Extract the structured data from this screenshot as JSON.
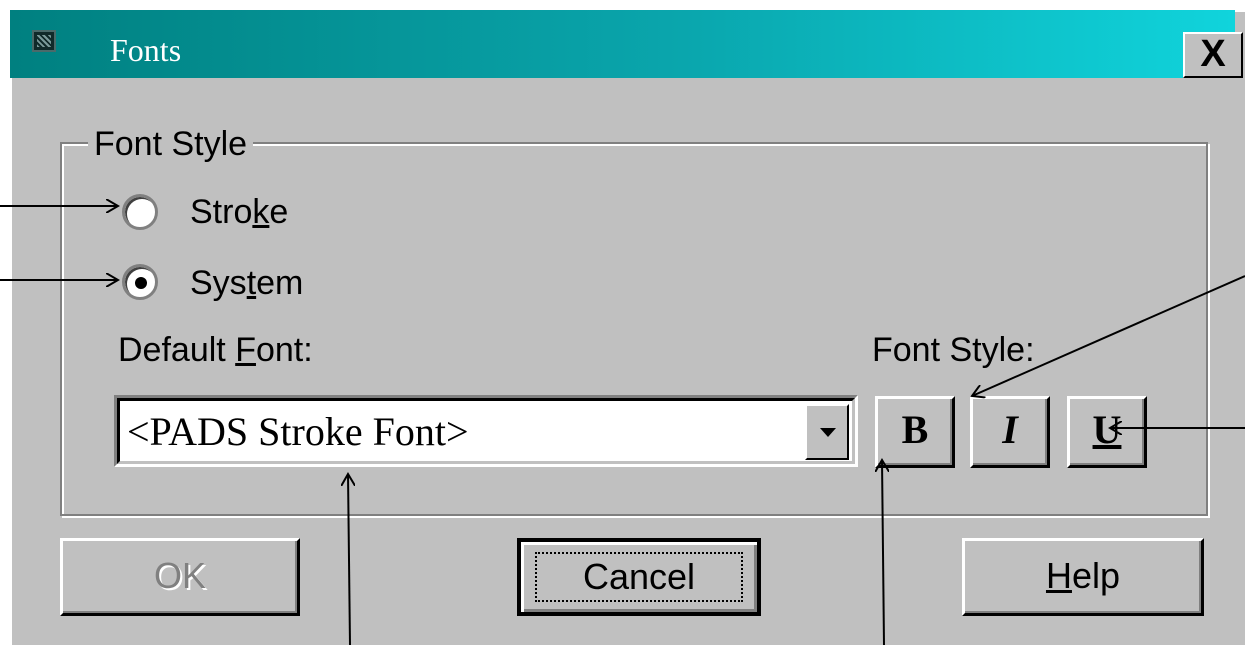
{
  "window": {
    "title": "Fonts",
    "close_label": "X"
  },
  "group": {
    "legend": "Font Style"
  },
  "radios": {
    "stroke": {
      "pre": "Stro",
      "accel": "k",
      "post": "e",
      "checked": false
    },
    "system": {
      "pre": "Sys",
      "accel": "t",
      "post": "em",
      "checked": true
    }
  },
  "default_font": {
    "label_pre": "Default ",
    "label_accel": "F",
    "label_post": "ont:",
    "value": "<PADS Stroke Font>"
  },
  "font_style": {
    "label": "Font Style:",
    "bold": "B",
    "italic": "I",
    "underline": "U"
  },
  "buttons": {
    "ok": "OK",
    "cancel": "Cancel",
    "help_accel": "H",
    "help_post": "elp"
  },
  "colors": {
    "title_gradient_start": "#008080",
    "title_gradient_end": "#10d4dc",
    "face": "#c0c0c0"
  }
}
